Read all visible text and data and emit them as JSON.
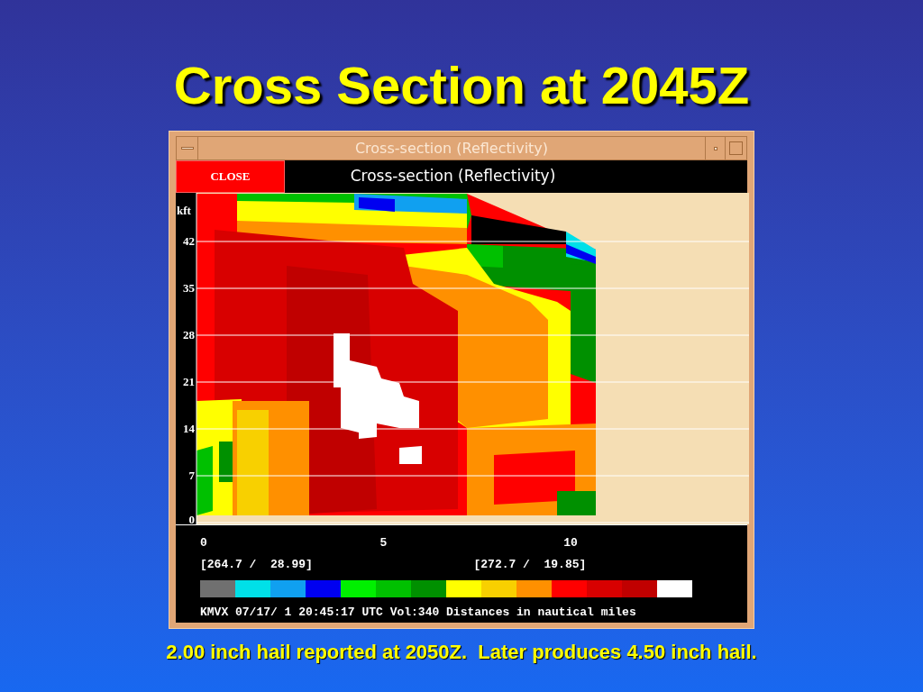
{
  "slide": {
    "title": "Cross Section at 2045Z",
    "caption": "2.00 inch hail reported at 2050Z.  Later produces 4.50 inch hail."
  },
  "window": {
    "title": "Cross-section (Reflectivity)",
    "close_button": "CLOSE",
    "header": "Cross-section (Reflectivity)",
    "y_axis": {
      "unit": "kft",
      "ticks": [
        "42",
        "35",
        "28",
        "21",
        "14",
        "7",
        "0"
      ]
    },
    "x_axis": {
      "ticks": [
        "0",
        "5",
        "10"
      ]
    },
    "endpoints": [
      "[264.7 /  28.99]",
      "[272.7 /  19.85]"
    ],
    "color_scale": [
      {
        "color": "#707070"
      },
      {
        "color": "#00e0e8"
      },
      {
        "color": "#10a0f0"
      },
      {
        "color": "#0000f0"
      },
      {
        "color": "#00f000"
      },
      {
        "color": "#00c000"
      },
      {
        "color": "#009000"
      },
      {
        "color": "#ffff00"
      },
      {
        "color": "#f8d000"
      },
      {
        "color": "#ff9000"
      },
      {
        "color": "#ff0000"
      },
      {
        "color": "#d80000"
      },
      {
        "color": "#c00000"
      },
      {
        "color": "#ffffff"
      }
    ],
    "status": "KMVX 07/17/ 1 20:45:17 UTC Vol:340 Distances in nautical miles"
  }
}
